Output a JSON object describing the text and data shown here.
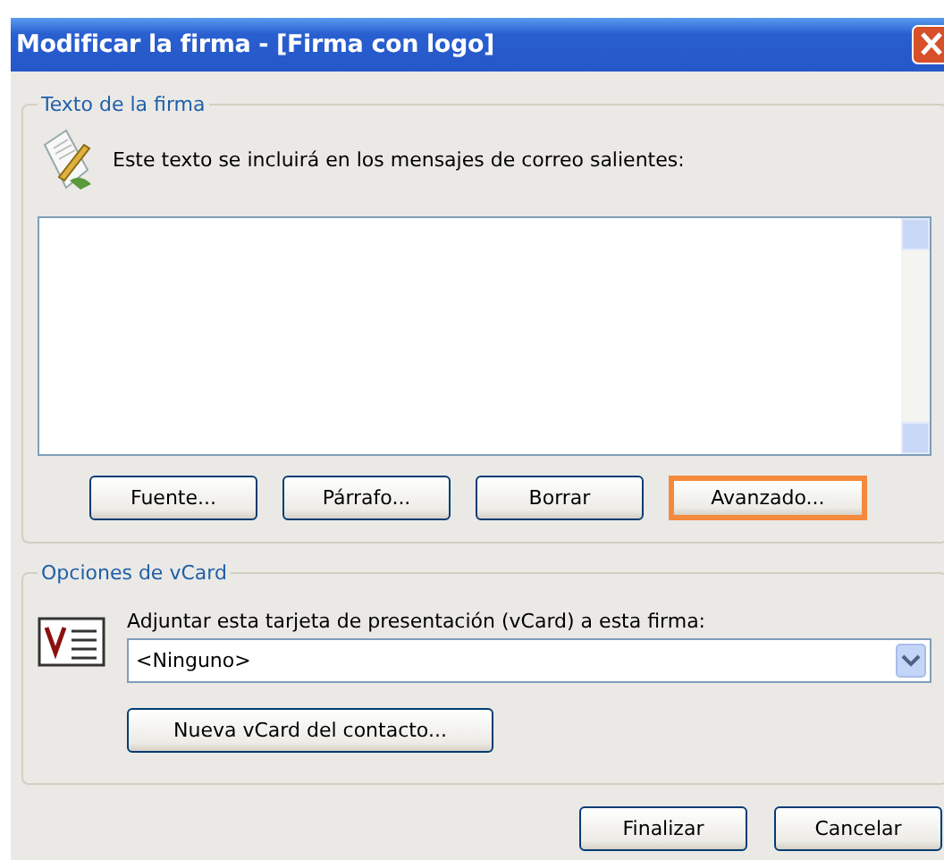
{
  "window": {
    "title": "Modificar la firma - [Firma con logo]"
  },
  "signature_group": {
    "legend": "Texto de la firma",
    "prompt": "Este texto se incluirá en los mensajes de correo salientes:",
    "buttons": [
      {
        "label": "Fuente...",
        "highlighted": false
      },
      {
        "label": "Párrafo...",
        "highlighted": false
      },
      {
        "label": "Borrar",
        "highlighted": false
      },
      {
        "label": "Avanzado...",
        "highlighted": true
      }
    ]
  },
  "vcard_group": {
    "legend": "Opciones de vCard",
    "prompt": "Adjuntar esta tarjeta de presentación (vCard) a esta firma:",
    "dropdown_value": "<Ninguno>",
    "new_button": "Nueva vCard del contacto..."
  },
  "footer_buttons": [
    "Finalizar",
    "Cancelar"
  ]
}
